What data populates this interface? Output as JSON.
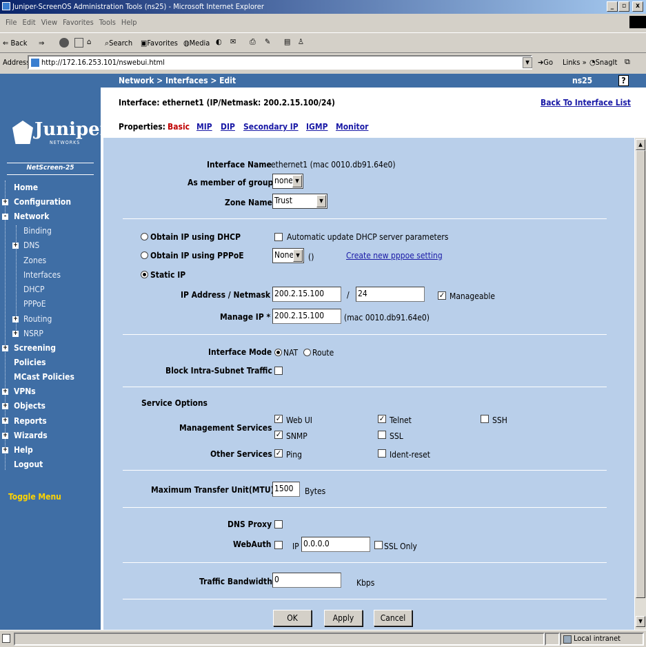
{
  "window": {
    "title": "Juniper-ScreenOS Administration Tools (ns25) - Microsoft Internet Explorer",
    "min": "_",
    "max": "▫",
    "close": "x"
  },
  "menu": [
    "File",
    "Edit",
    "View",
    "Favorites",
    "Tools",
    "Help"
  ],
  "toolbar": {
    "back": "Back",
    "search": "Search",
    "favorites": "Favorites",
    "media": "Media"
  },
  "address": {
    "label": "Address",
    "url": "http://172.16.253.101/nswebui.html",
    "go": "Go",
    "links": "Links",
    "snagit": "SnagIt"
  },
  "header": {
    "breadcrumb": "Network > Interfaces > Edit",
    "device": "ns25",
    "help": "?"
  },
  "page": {
    "interface_title": "Interface: ethernet1 (IP/Netmask: 200.2.15.100/24)",
    "back_link": "Back To Interface List",
    "properties_label": "Properties:",
    "tabs": [
      "Basic",
      "MIP",
      "DIP",
      "Secondary IP",
      "IGMP",
      "Monitor"
    ]
  },
  "sidebar": {
    "logo": "Juniper",
    "logo_sub": "NETWORKS",
    "model": "NetScreen-25",
    "items": [
      {
        "label": "Home",
        "expander": ""
      },
      {
        "label": "Configuration",
        "expander": "+"
      },
      {
        "label": "Network",
        "expander": "-"
      },
      {
        "label": "Binding",
        "expander": ""
      },
      {
        "label": "DNS",
        "expander": "+"
      },
      {
        "label": "Zones",
        "expander": ""
      },
      {
        "label": "Interfaces",
        "expander": ""
      },
      {
        "label": "DHCP",
        "expander": ""
      },
      {
        "label": "PPPoE",
        "expander": ""
      },
      {
        "label": "Routing",
        "expander": "+"
      },
      {
        "label": "NSRP",
        "expander": "+"
      },
      {
        "label": "Screening",
        "expander": "+"
      },
      {
        "label": "Policies",
        "expander": ""
      },
      {
        "label": "MCast Policies",
        "expander": ""
      },
      {
        "label": "VPNs",
        "expander": "+"
      },
      {
        "label": "Objects",
        "expander": "+"
      },
      {
        "label": "Reports",
        "expander": "+"
      },
      {
        "label": "Wizards",
        "expander": "+"
      },
      {
        "label": "Help",
        "expander": "+"
      },
      {
        "label": "Logout",
        "expander": ""
      }
    ],
    "toggle": "Toggle Menu"
  },
  "form": {
    "interface_name_label": "Interface Name",
    "interface_name_value": "ethernet1 (mac 0010.db91.64e0)",
    "member_group_label": "As member of group",
    "member_group_value": "none",
    "zone_label": "Zone Name",
    "zone_value": "Trust",
    "dhcp_label": "Obtain IP using DHCP",
    "dhcp_auto_label": "Automatic update DHCP server parameters",
    "pppoe_label": "Obtain IP using PPPoE",
    "pppoe_value": "None",
    "pppoe_paren": "()",
    "pppoe_link": "Create new pppoe setting",
    "static_label": "Static IP",
    "ip_label": "IP Address / Netmask",
    "ip_value": "200.2.15.100",
    "slash": "/",
    "mask_value": "24",
    "manageable_label": "Manageable",
    "manage_ip_label": "Manage IP *",
    "manage_ip_value": "200.2.15.100",
    "manage_ip_mac": "(mac 0010.db91.64e0)",
    "mode_label": "Interface Mode",
    "mode_nat": "NAT",
    "mode_route": "Route",
    "block_label": "Block Intra-Subnet Traffic",
    "service_options": "Service Options",
    "mgmt_label": "Management Services",
    "webui": "Web UI",
    "telnet": "Telnet",
    "ssh": "SSH",
    "snmp": "SNMP",
    "ssl": "SSL",
    "other_label": "Other Services",
    "ping": "Ping",
    "ident": "Ident-reset",
    "mtu_label": "Maximum Transfer Unit(MTU)",
    "mtu_value": "1500",
    "mtu_unit": "Bytes",
    "dns_proxy_label": "DNS Proxy",
    "webauth_label": "WebAuth",
    "webauth_ip_label": "IP",
    "webauth_ip_value": "0.0.0.0",
    "ssl_only": "SSL Only",
    "bandwidth_label": "Traffic Bandwidth",
    "bandwidth_value": "0",
    "bandwidth_unit": "Kbps",
    "ok": "OK",
    "apply": "Apply",
    "cancel": "Cancel"
  },
  "status": {
    "zone": "Local intranet"
  }
}
